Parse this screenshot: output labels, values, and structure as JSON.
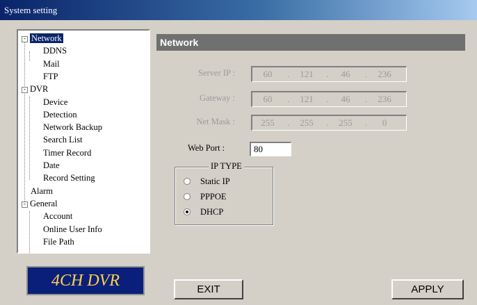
{
  "window": {
    "title": "System setting"
  },
  "tree": {
    "items": [
      {
        "label": "Network",
        "level": 0,
        "expander": "-",
        "selected": true
      },
      {
        "label": "DDNS",
        "level": 1
      },
      {
        "label": "Mail",
        "level": 1
      },
      {
        "label": "FTP",
        "level": 1
      },
      {
        "label": "DVR",
        "level": 0,
        "expander": "-"
      },
      {
        "label": "Device",
        "level": 1
      },
      {
        "label": "Detection",
        "level": 1
      },
      {
        "label": "Network Backup",
        "level": 1
      },
      {
        "label": "Search List",
        "level": 1
      },
      {
        "label": "Timer Record",
        "level": 1
      },
      {
        "label": "Date",
        "level": 1
      },
      {
        "label": "Record Setting",
        "level": 1
      },
      {
        "label": "Alarm",
        "level": 0
      },
      {
        "label": "General",
        "level": 0,
        "expander": "-"
      },
      {
        "label": "Account",
        "level": 1
      },
      {
        "label": "Online User Info",
        "level": 1
      },
      {
        "label": "File Path",
        "level": 1
      }
    ]
  },
  "logo": {
    "text": "4CH DVR"
  },
  "panel": {
    "title": "Network",
    "server_ip": {
      "label": "Server IP :",
      "octets": [
        "60",
        "121",
        "46",
        "236"
      ]
    },
    "gateway": {
      "label": "Gateway :",
      "octets": [
        "60",
        "121",
        "46",
        "236"
      ]
    },
    "netmask": {
      "label": "Net Mask :",
      "octets": [
        "255",
        "255",
        "255",
        "0"
      ]
    },
    "web_port": {
      "label": "Web Port :",
      "value": "80"
    },
    "ip_type": {
      "title": "IP TYPE",
      "options": [
        {
          "label": "Static IP",
          "checked": false
        },
        {
          "label": "PPPOE",
          "checked": false
        },
        {
          "label": "DHCP",
          "checked": true
        }
      ]
    }
  },
  "buttons": {
    "exit": "EXIT",
    "apply": "APPLY"
  },
  "colors": {
    "title_bar": "#0a246a",
    "panel_header": "#707070",
    "logo_bg": "#0a1f7a",
    "logo_text": "#ffd24a"
  }
}
